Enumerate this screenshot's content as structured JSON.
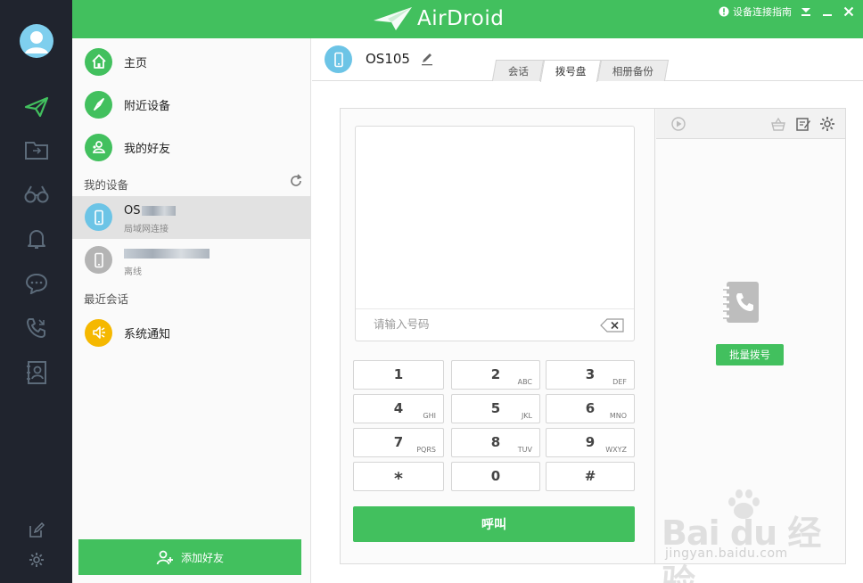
{
  "app": {
    "brand": "AirDroid"
  },
  "header": {
    "guide_label": "设备连接指南",
    "controls": [
      "chevron-down-icon",
      "minimize-icon",
      "close-icon"
    ]
  },
  "rail": {
    "items": [
      "transfer-icon",
      "files-icon",
      "binoculars-icon",
      "bell-icon",
      "chat-icon",
      "phone-icon",
      "contacts-icon",
      "edit-icon",
      "gear-icon"
    ]
  },
  "contacts": {
    "menu": [
      {
        "label": "主页",
        "icon": "home-icon"
      },
      {
        "label": "附近设备",
        "icon": "compass-icon"
      },
      {
        "label": "我的好友",
        "icon": "friends-icon"
      }
    ],
    "my_devices_title": "我的设备",
    "devices": [
      {
        "name": "OS",
        "status": "局域网连接",
        "selected": true
      },
      {
        "name": "",
        "status": "离线",
        "selected": false
      }
    ],
    "recent_title": "最近会话",
    "recent": [
      {
        "label": "系统通知",
        "icon": "speaker-icon"
      }
    ],
    "add_friend_label": "添加好友"
  },
  "main": {
    "device_title": "OS105",
    "tabs": [
      {
        "label": "会话",
        "active": false
      },
      {
        "label": "拨号盘",
        "active": true
      },
      {
        "label": "相册备份",
        "active": false
      }
    ]
  },
  "dialer": {
    "input_placeholder": "请输入号码",
    "keys": [
      {
        "digit": "1",
        "letters": ""
      },
      {
        "digit": "2",
        "letters": "ABC"
      },
      {
        "digit": "3",
        "letters": "DEF"
      },
      {
        "digit": "4",
        "letters": "GHI"
      },
      {
        "digit": "5",
        "letters": "JKL"
      },
      {
        "digit": "6",
        "letters": "MNO"
      },
      {
        "digit": "7",
        "letters": "PQRS"
      },
      {
        "digit": "8",
        "letters": "TUV"
      },
      {
        "digit": "9",
        "letters": "WXYZ"
      },
      {
        "digit": "*",
        "letters": ""
      },
      {
        "digit": "0",
        "letters": ""
      },
      {
        "digit": "#",
        "letters": ""
      }
    ],
    "call_label": "呼叫",
    "batch_label": "批量拨号"
  },
  "watermark": {
    "main": "Bai du 经验",
    "url": "jingyan.baidu.com"
  },
  "colors": {
    "accent": "#42c05e",
    "rail": "#20242e",
    "device_blue": "#6cc4e6",
    "offline_grey": "#b4b4b4",
    "notice_yellow": "#f5b800"
  }
}
